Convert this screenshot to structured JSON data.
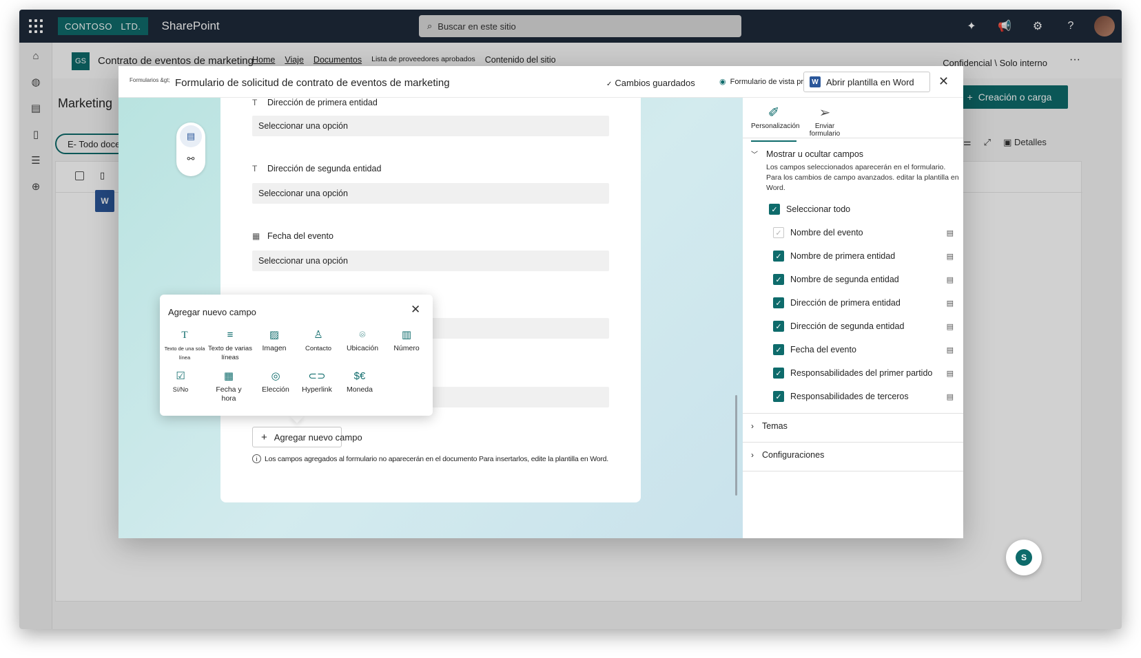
{
  "suite": {
    "brand": "CONTOSO   LTD.",
    "product": "SharePoint",
    "search_placeholder": "Buscar en este sitio"
  },
  "site": {
    "icon": "GS",
    "title": "Contrato de eventos de marketing",
    "nav": [
      "Home",
      "Viaje",
      "Documentos",
      "Lista de proveedores aprobados",
      "Contenido del sitio"
    ],
    "sensitivity": "Confidencial \\ Solo interno"
  },
  "background": {
    "library_title": "Marketing",
    "view_pill": "E- Todo docent",
    "create_button": "Creación o carga",
    "details": "Detalles"
  },
  "dialog": {
    "breadcrumb": "Formularios &gt;",
    "title": "Formulario de solicitud de contrato de eventos de marketing",
    "saved": "Cambios guardados",
    "preview": "Formulario de vista previa",
    "open_word": "Abrir plantilla en Word"
  },
  "form": {
    "placeholder": "Seleccionar una opción",
    "fields": [
      {
        "label": "Dirección de primera entidad",
        "icon": "text-icon"
      },
      {
        "label": "Dirección de segunda entidad",
        "icon": "text-icon"
      },
      {
        "label": "Fecha del evento",
        "icon": "calendar-icon"
      }
    ],
    "add_field": "Agregar nuevo campo",
    "note": "Los campos agregados al formulario no aparecerán en el documento Para insertarlos, edite la plantilla en Word."
  },
  "popup": {
    "title": "Agregar nuevo campo",
    "types": [
      {
        "label": "Texto de una sola línea",
        "icon": "single-line-text-icon"
      },
      {
        "label": "Texto de varias líneas",
        "icon": "multi-line-text-icon"
      },
      {
        "label": "Imagen",
        "icon": "image-icon"
      },
      {
        "label": "Contacto",
        "icon": "contact-icon"
      },
      {
        "label": "Ubicación",
        "icon": "location-icon"
      },
      {
        "label": "Número",
        "icon": "number-icon"
      },
      {
        "label": "Sí/No",
        "icon": "yes-no-icon"
      },
      {
        "label": "Fecha y hora",
        "icon": "date-time-icon"
      },
      {
        "label": "Elección",
        "icon": "choice-icon"
      },
      {
        "label": "Hyperlink",
        "icon": "hyperlink-icon"
      },
      {
        "label": "Moneda",
        "icon": "currency-icon"
      }
    ]
  },
  "panel": {
    "tabs": [
      "Personalización",
      "Enviar formulario"
    ],
    "show_hide_title": "Mostrar u ocultar campos",
    "show_hide_desc": "Los campos seleccionados aparecerán en el formulario. Para los cambios de campo avanzados. editar la plantilla en Word.",
    "select_all": "Seleccionar todo",
    "fields": [
      {
        "label": "Nombre del evento",
        "checked": true,
        "disabled": true
      },
      {
        "label": "Nombre de primera entidad",
        "checked": true,
        "disabled": false
      },
      {
        "label": "Nombre de segunda entidad",
        "checked": true,
        "disabled": false
      },
      {
        "label": "Dirección de primera entidad",
        "checked": true,
        "disabled": false
      },
      {
        "label": "Dirección de segunda entidad",
        "checked": true,
        "disabled": false
      },
      {
        "label": "Fecha del evento",
        "checked": true,
        "disabled": false
      },
      {
        "label": "Responsabilidades del primer partido",
        "checked": true,
        "disabled": false
      },
      {
        "label": "Responsabilidades de terceros",
        "checked": true,
        "disabled": false
      }
    ],
    "themes": "Temas",
    "settings": "Configuraciones"
  },
  "colors": {
    "accent": "#0e6b6b",
    "suitebar": "#1e2a3a"
  }
}
